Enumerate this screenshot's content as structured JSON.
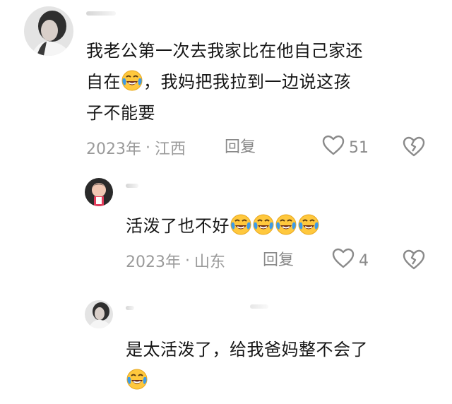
{
  "comments": [
    {
      "text_lines": [
        "我老公第一次去我家比在他自己家还",
        "自在",
        "，我妈把我拉到一边说这孩",
        "子不能要"
      ],
      "meta": {
        "year": "2023年",
        "separator": "·",
        "location": "江西"
      },
      "reply_label": "回复",
      "likes": "51"
    },
    {
      "text": "活泼了也不好",
      "meta": {
        "year": "2023年",
        "separator": "·",
        "location": "山东"
      },
      "reply_label": "回复",
      "likes": "4"
    },
    {
      "text_lines": [
        "是太活泼了，给我爸妈整不会了"
      ]
    }
  ],
  "icons": {
    "emoji": "laughing-crying-emoji",
    "like": "heart-outline-icon",
    "dislike": "broken-heart-icon"
  },
  "colors": {
    "text": "#161616",
    "meta": "#9a9a9a",
    "icon": "#8a8a8a",
    "emoji_face": "#ffc83d",
    "emoji_tear": "#3b9bea"
  }
}
